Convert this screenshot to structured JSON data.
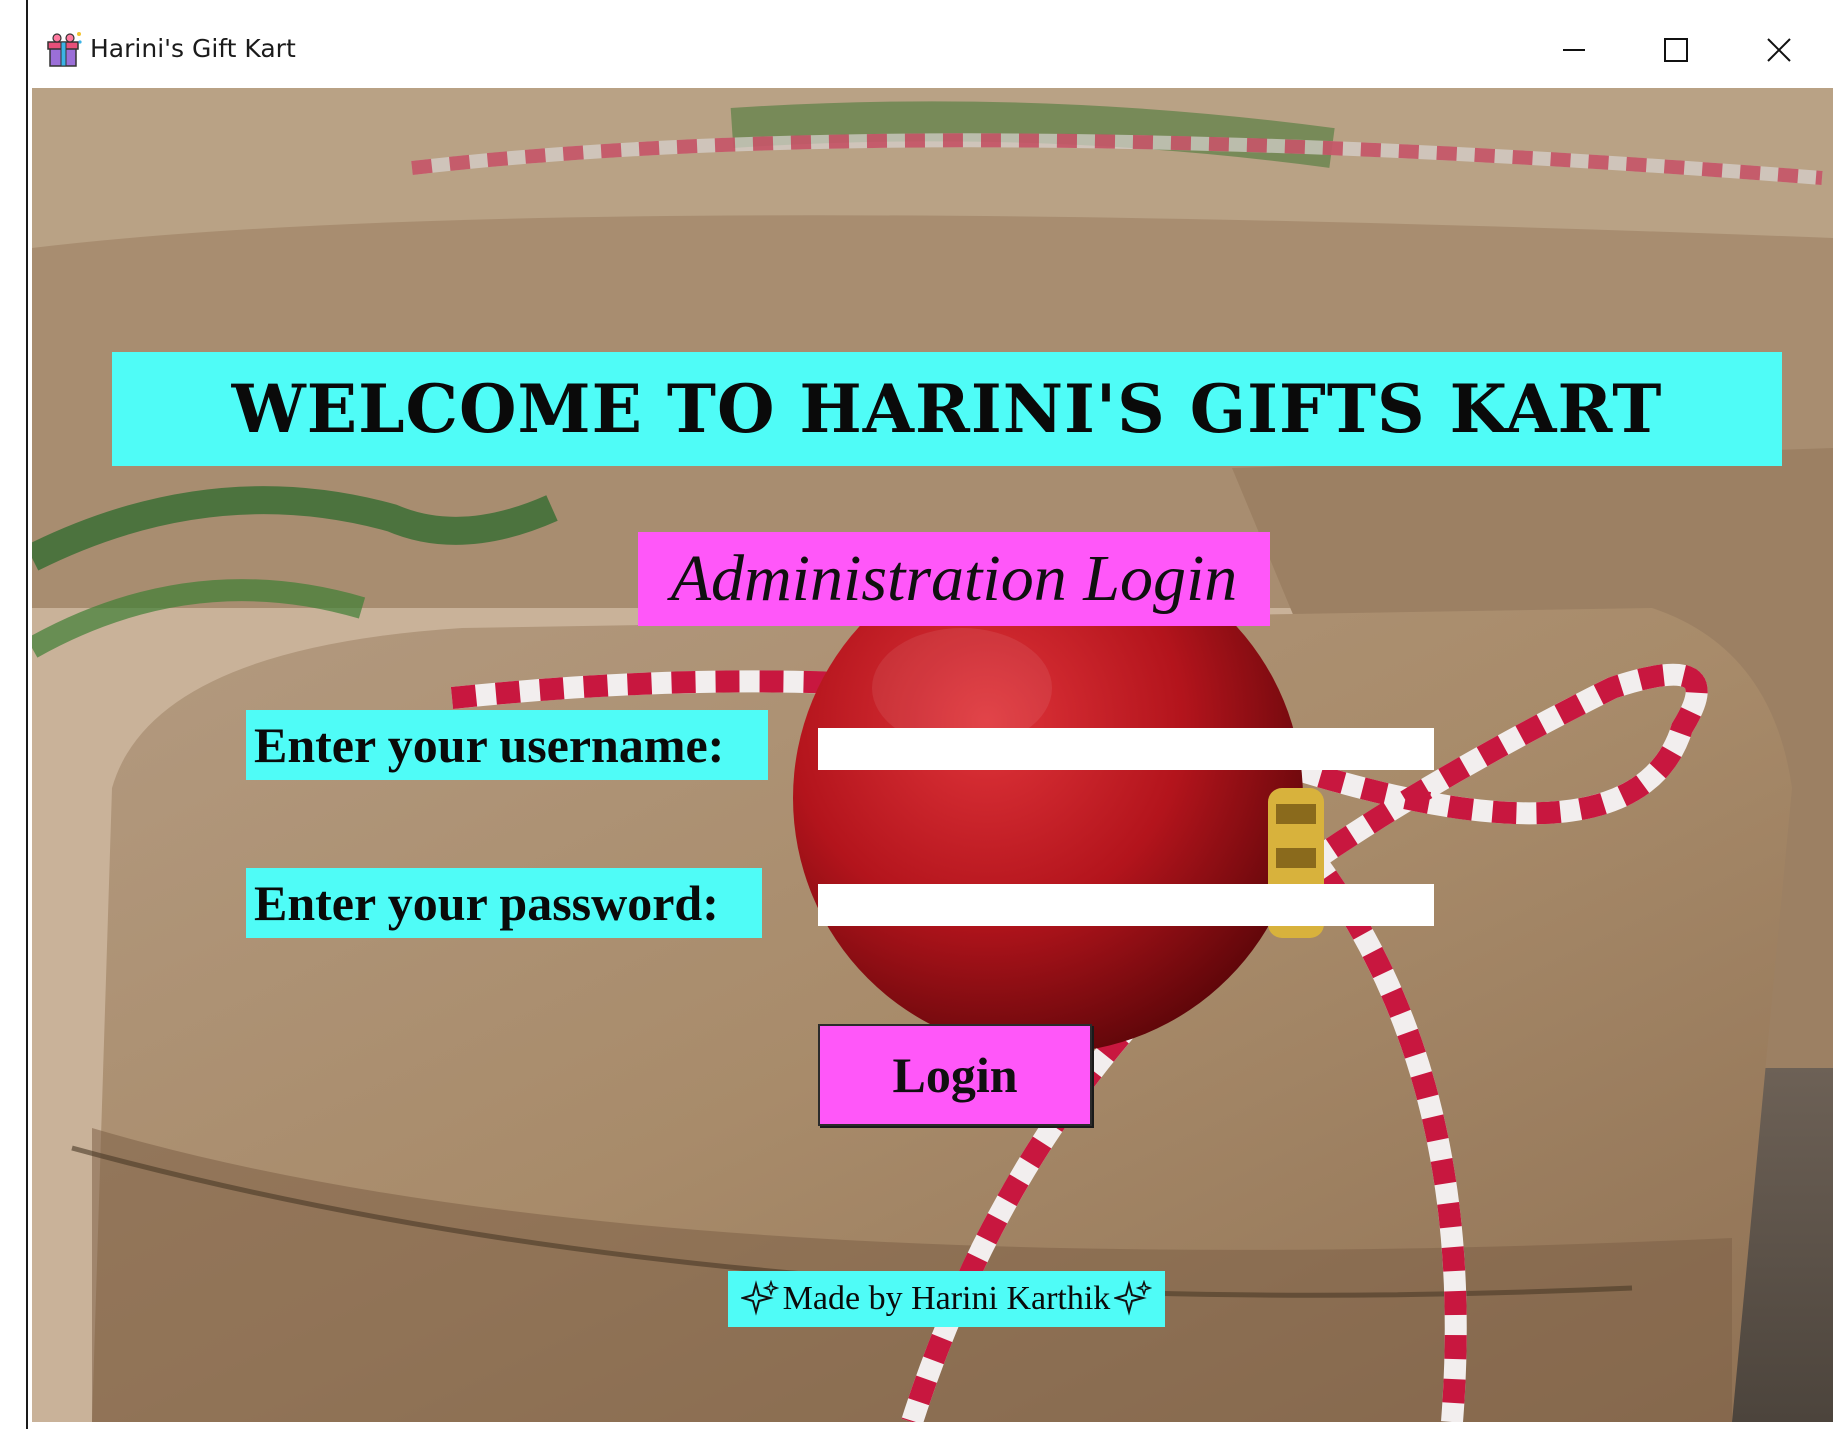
{
  "window": {
    "title": "Harini's Gift Kart",
    "icon": "gift-icon",
    "controls": [
      "minimize-icon",
      "maximize-icon",
      "close-icon"
    ]
  },
  "main": {
    "welcome_text": "WELCOME TO HARINI'S GIFTS KART",
    "subtitle": "Administration Login",
    "username_label": "Enter your username:",
    "username_value": "",
    "password_label": "Enter your password:",
    "password_value": "",
    "login_label": "Login",
    "credit_text": "Made by Harini Karthik",
    "credit_icon": "sparkles-icon"
  },
  "colors": {
    "banner_cyan": "#4ffcf7",
    "banner_magenta": "#ff57f9",
    "field_bg": "#ffffff"
  }
}
